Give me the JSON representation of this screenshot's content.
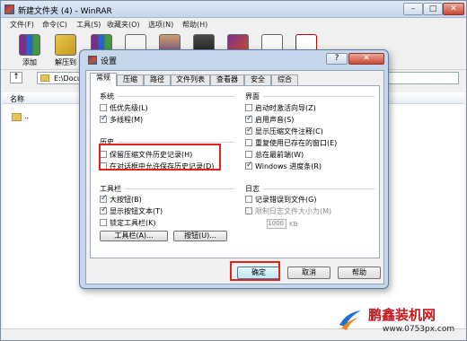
{
  "window": {
    "title": "新建文件夹 (4) - WinRAR",
    "controls": {
      "minimize": "–",
      "maximize": "□",
      "close": "✕"
    }
  },
  "menu": [
    "文件(F)",
    "命令(C)",
    "工具(S)",
    "收藏夹(O)",
    "选项(N)",
    "帮助(H)"
  ],
  "toolbar": {
    "buttons": [
      {
        "label": "添加",
        "icon": "add-archive-icon"
      },
      {
        "label": "解压到",
        "icon": "extract-to-icon"
      },
      {
        "label": "",
        "icon": "test-icon"
      },
      {
        "label": "",
        "icon": "view-icon"
      },
      {
        "label": "",
        "icon": "delete-icon"
      },
      {
        "label": "",
        "icon": "find-icon"
      },
      {
        "label": "",
        "icon": "wizard-icon"
      },
      {
        "label": "",
        "icon": "info-icon"
      },
      {
        "label": "",
        "icon": "repair-icon"
      }
    ]
  },
  "address": {
    "path": "E:\\Docu"
  },
  "list": {
    "header": "名称",
    "rows": [
      ".."
    ]
  },
  "dialog": {
    "title": "设置",
    "help_button": "?",
    "close_button": "✕",
    "tabs": [
      "常规",
      "压缩",
      "路径",
      "文件列表",
      "查看器",
      "安全",
      "综合"
    ],
    "active_tab": "常规",
    "groups": {
      "system": {
        "title": "系统",
        "options": [
          {
            "label": "低优先级(L)",
            "checked": false
          },
          {
            "label": "多线程(M)",
            "checked": true
          }
        ]
      },
      "history": {
        "title": "历史",
        "options": [
          {
            "label": "保留压缩文件历史记录(H)",
            "checked": false
          },
          {
            "label": "在对话框中允许保存历史记录(D)",
            "checked": false
          }
        ]
      },
      "toolbar": {
        "title": "工具栏",
        "options": [
          {
            "label": "大按钮(B)",
            "checked": true
          },
          {
            "label": "显示按钮文本(T)",
            "checked": true
          },
          {
            "label": "锁定工具栏(K)",
            "checked": false
          }
        ],
        "buttons": [
          "工具栏(A)...",
          "按钮(U)..."
        ]
      },
      "interface": {
        "title": "界面",
        "options": [
          {
            "label": "启动时激活向导(Z)",
            "checked": false
          },
          {
            "label": "启用声音(S)",
            "checked": true
          },
          {
            "label": "显示压缩文件注释(C)",
            "checked": true
          },
          {
            "label": "重复使用已存在的窗口(E)",
            "checked": false
          },
          {
            "label": "总在最前端(W)",
            "checked": false
          },
          {
            "label": "Windows 进度条(R)",
            "checked": true
          }
        ]
      },
      "log": {
        "title": "日志",
        "options": [
          {
            "label": "记录错误到文件(G)",
            "checked": false
          },
          {
            "label": "限制日志文件大小为(M)",
            "checked": false,
            "disabled": true
          }
        ],
        "size_value": "1000",
        "size_unit": "KB"
      }
    },
    "buttons": {
      "ok": "确定",
      "cancel": "取消",
      "help": "帮助"
    }
  },
  "watermark": {
    "brand": "鹏鑫装机网",
    "url": "www.0753px.com"
  },
  "colors": {
    "highlight_box": "#e2231a",
    "title_gradient": "#c4d5ea",
    "watermark_red": "#c8161d"
  }
}
